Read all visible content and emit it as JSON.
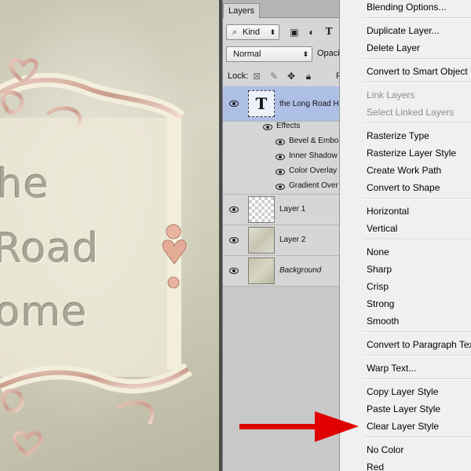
{
  "canvas": {
    "text_lines": [
      "he",
      "Road",
      "ome"
    ]
  },
  "layers_panel": {
    "tab_label": "Layers",
    "filter_kind": "Kind",
    "blend_mode": "Normal",
    "opacity_label": "Opacit",
    "lock_label": "Lock:",
    "fill_label": "F",
    "layers": [
      {
        "name": "the Long Road H",
        "thumb": "type",
        "active": true,
        "effects_label": "Effects",
        "effects": [
          "Bevel & Embos",
          "Inner Shadow",
          "Color Overlay",
          "Gradient Over"
        ]
      },
      {
        "name": "Layer 1",
        "thumb": "checker"
      },
      {
        "name": "Layer 2",
        "thumb": "texture"
      },
      {
        "name": "Background",
        "thumb": "texture"
      }
    ]
  },
  "context_menu": {
    "items": [
      "Blending Options...",
      "Duplicate Layer...",
      "Delete Layer",
      "Convert to Smart Object",
      "Link Layers",
      "Select Linked Layers",
      "Rasterize Type",
      "Rasterize Layer Style",
      "Create Work Path",
      "Convert to Shape",
      "Horizontal",
      "Vertical",
      "None",
      "Sharp",
      "Crisp",
      "Strong",
      "Smooth",
      "Convert to Paragraph Text",
      "Warp Text...",
      "Copy Layer Style",
      "Paste Layer Style",
      "Clear Layer Style",
      "No Color",
      "Red"
    ],
    "disabled_items": [
      "Link Layers",
      "Select Linked Layers"
    ],
    "highlighted_item": "Clear Layer Style"
  },
  "colors": {
    "arrow": "#e00000",
    "active_layer": "#aebfe6",
    "menu_bg": "#f0f0f0"
  }
}
